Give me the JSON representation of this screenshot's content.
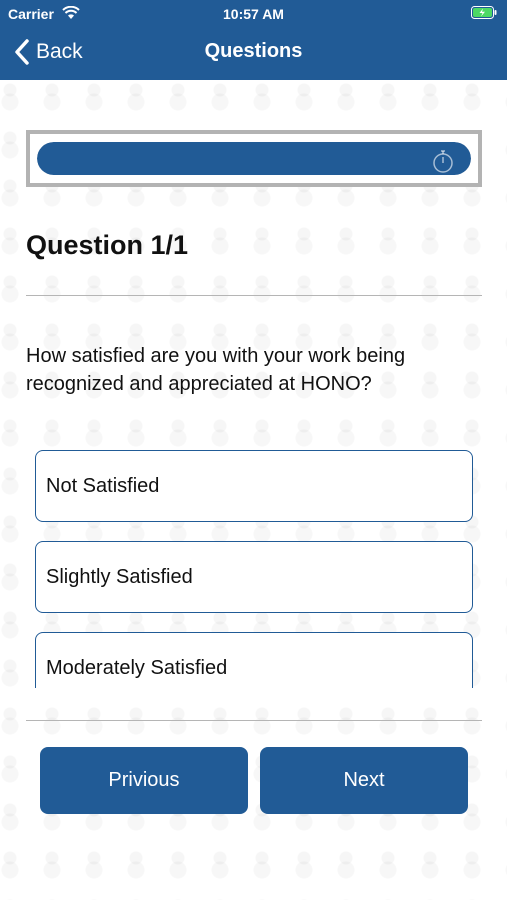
{
  "status_bar": {
    "carrier": "Carrier",
    "time": "10:57 AM"
  },
  "nav": {
    "back_label": "Back",
    "title": "Questions"
  },
  "timer": {
    "progress": 1.0
  },
  "question": {
    "heading": "Question 1/1",
    "text": "How satisfied are you with your work being recognized and appreciated at HONO?",
    "options": [
      {
        "label": "Not Satisfied"
      },
      {
        "label": "Slightly Satisfied"
      },
      {
        "label": "Moderately Satisfied"
      }
    ]
  },
  "buttons": {
    "previous_label": "Privious",
    "next_label": "Next"
  },
  "colors": {
    "accent": "#215b96",
    "timer_border": "#b3b3b3",
    "divider": "#b5b5b5",
    "battery": "#4cd964"
  }
}
